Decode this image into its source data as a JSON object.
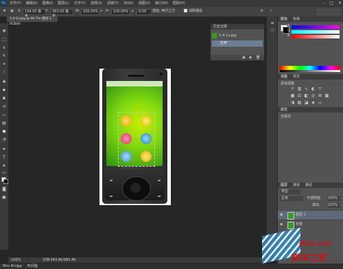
{
  "app": {
    "logo": "Ps",
    "menu": [
      "文件(F)",
      "编辑(E)",
      "图像(I)",
      "图层(L)",
      "文字(Y)",
      "选择(S)",
      "滤镜(T)",
      "3D(D)",
      "视图(V)",
      "窗口(W)",
      "帮助(H)"
    ],
    "window_controls": [
      "–",
      "□",
      "✕"
    ]
  },
  "options_bar": {
    "x_label": "X:",
    "x_value": "134.50 像素",
    "y_label": "Y:",
    "y_value": "263.00 像素",
    "w_label": "W:",
    "w_value": "100.00%",
    "h_label": "H:",
    "h_value": "100.00%",
    "angle_value": "0.00",
    "interp_label": "插值: 两次立方",
    "checkbox_label": "消除锯齿"
  },
  "document": {
    "tab_title": "1-4-1a.jpg @ 66.7% (图层 1, RGB/8)",
    "zoom": "100%",
    "status": "文档:483.6K/983.4K"
  },
  "history_panel": {
    "title": "历史记录",
    "snapshot": "1-4-1a.jpg",
    "state": "打开"
  },
  "right_dock": {
    "color_tabs": [
      "颜色",
      "色板"
    ],
    "sliders": [
      "R",
      "G",
      "B"
    ],
    "adjust_tabs": [
      "调整",
      "样式"
    ],
    "adjust_hint": "添加调整",
    "props_title": "属性",
    "props_hint": "无属性",
    "layers_tabs": [
      "图层",
      "通道",
      "路径"
    ],
    "layer_kind": "类型",
    "blend_mode": "正常",
    "opacity_label": "不透明度:",
    "opacity_value": "100%",
    "fill_label": "填充:",
    "fill_value": "100%",
    "layers": [
      {
        "name": "图层 1"
      },
      {
        "name": "背景"
      }
    ]
  },
  "bottom_bar": {
    "mini_bridge": "Mini Bridge",
    "timeline": "时间轴"
  },
  "watermark": {
    "site": "jb51.net",
    "name": "脚本之家"
  },
  "colors": {
    "accent_selection": "#6d7f95",
    "watermark_red": "#c21818"
  }
}
